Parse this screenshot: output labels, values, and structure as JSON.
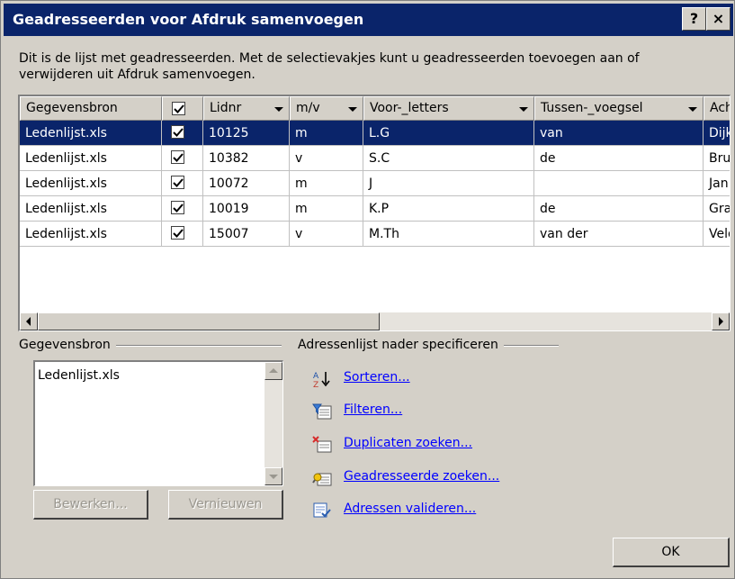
{
  "dialog": {
    "title": "Geadresseerden voor Afdruk samenvoegen",
    "help_label": "?",
    "close_label": "×",
    "intro": "Dit is de lijst met geadresseerden. Met de selectievakjes kunt u geadresseerden toevoegen aan of verwijderen uit Afdruk samenvoegen."
  },
  "grid": {
    "columns": [
      {
        "label": "Gegevensbron"
      },
      {
        "label": "✔"
      },
      {
        "label": "Lidnr"
      },
      {
        "label": "m/v"
      },
      {
        "label": "Voor-_letters"
      },
      {
        "label": "Tussen-_voegsel"
      },
      {
        "label": "Ach"
      }
    ],
    "rows": [
      {
        "source": "Ledenlijst.xls",
        "checked": true,
        "lidnr": "10125",
        "mv": "m",
        "voorletters": "L.G",
        "tussenvoegsel": "van",
        "achternaam": "Dijk",
        "selected": true
      },
      {
        "source": "Ledenlijst.xls",
        "checked": true,
        "lidnr": "10382",
        "mv": "v",
        "voorletters": "S.C",
        "tussenvoegsel": "de",
        "achternaam": "Bru"
      },
      {
        "source": "Ledenlijst.xls",
        "checked": true,
        "lidnr": "10072",
        "mv": "m",
        "voorletters": "J",
        "tussenvoegsel": "",
        "achternaam": "Jan"
      },
      {
        "source": "Ledenlijst.xls",
        "checked": true,
        "lidnr": "10019",
        "mv": "m",
        "voorletters": "K.P",
        "tussenvoegsel": "de",
        "achternaam": "Gra"
      },
      {
        "source": "Ledenlijst.xls",
        "checked": true,
        "lidnr": "15007",
        "mv": "v",
        "voorletters": "M.Th",
        "tussenvoegsel": "van der",
        "achternaam": "Veld"
      }
    ]
  },
  "source_group": {
    "label": "Gegevensbron",
    "items": [
      "Ledenlijst.xls"
    ],
    "edit_label": "Bewerken...",
    "refresh_label": "Vernieuwen"
  },
  "refine_group": {
    "label": "Adressenlijst nader specificeren",
    "actions": [
      {
        "label": "Sorteren...",
        "icon": "sort-icon"
      },
      {
        "label": "Filteren...",
        "icon": "filter-icon"
      },
      {
        "label": "Duplicaten zoeken...",
        "icon": "duplicates-icon"
      },
      {
        "label": "Geadresseerde zoeken...",
        "icon": "find-recipient-icon"
      },
      {
        "label": "Adressen valideren...",
        "icon": "validate-icon"
      }
    ]
  },
  "ok_label": "OK",
  "colors": {
    "title_bar": "#0a246a",
    "selection": "#0a246a",
    "link": "#0000ff",
    "face": "#d4d0c8"
  }
}
